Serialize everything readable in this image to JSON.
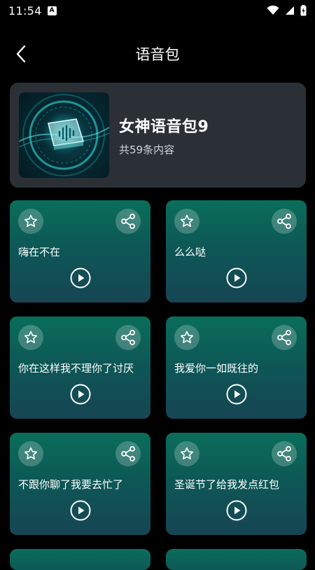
{
  "status_bar": {
    "time": "11:54",
    "notification_icon": "A",
    "icons": [
      "wifi-icon",
      "cellular-signal-icon",
      "battery-charging-icon"
    ]
  },
  "header": {
    "title": "语音包",
    "back_icon": "chevron-left-icon"
  },
  "pack": {
    "title": "女神语音包9",
    "count_text": "共59条内容"
  },
  "voices": [
    {
      "title": "嗨在不在"
    },
    {
      "title": "么么哒"
    },
    {
      "title": "你在这样我不理你了讨厌"
    },
    {
      "title": "我爱你一如既往的"
    },
    {
      "title": "不跟你聊了我要去忙了"
    },
    {
      "title": "圣诞节了给我发点红包"
    }
  ],
  "colors": {
    "background": "#000000",
    "pack_card": "#2b2f36",
    "voice_card_top": "#0a6e5a",
    "voice_card_bottom": "#164554"
  }
}
